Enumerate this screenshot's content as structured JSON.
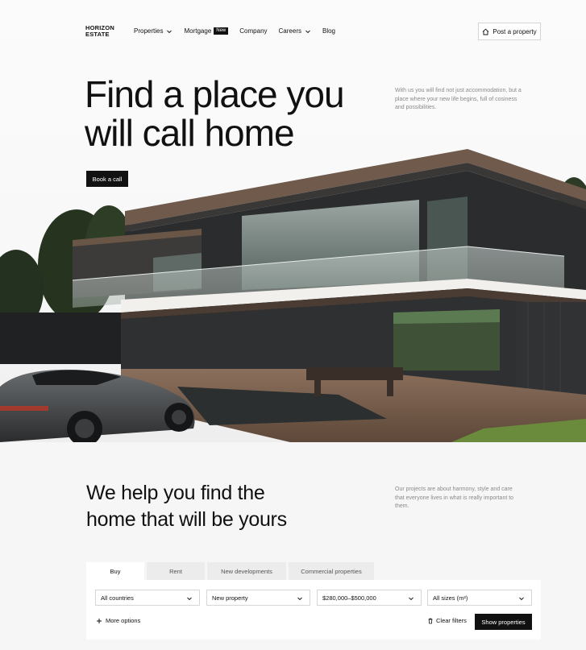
{
  "brand": {
    "logo_line1": "HORIZON",
    "logo_line2": "ESTATE"
  },
  "nav": {
    "items": [
      {
        "label": "Properties",
        "dropdown": true
      },
      {
        "label": "Mortgage",
        "badge": "New"
      },
      {
        "label": "Company"
      },
      {
        "label": "Careers",
        "dropdown": true
      },
      {
        "label": "Blog"
      }
    ],
    "post_button": "Post a property"
  },
  "hero": {
    "title_line1": "Find a place you",
    "title_line2": "will call home",
    "subtitle": "With us you will find not just accommodation, but a place where your new life begins, full of cosiness and possibilities.",
    "cta": "Book a call"
  },
  "section2": {
    "title_line1": "We help you find the",
    "title_line2": "home that will be yours",
    "subtitle": "Our projects are about harmony, style and care that everyone lives in what is really important to them."
  },
  "search": {
    "tabs": [
      "Buy",
      "Rent",
      "New developments",
      "Commercial properties"
    ],
    "active_tab": "Buy",
    "filters": {
      "country": "All countries",
      "type": "New property",
      "price": "$280,000–$500,000",
      "size": "All sizes (m²)"
    },
    "more_options": "More options",
    "clear_filters": "Clear filters",
    "show_button": "Show properties"
  },
  "colors": {
    "primary": "#111111",
    "muted_text": "#8a8a8a",
    "page_bg": "#f6f6f6"
  }
}
